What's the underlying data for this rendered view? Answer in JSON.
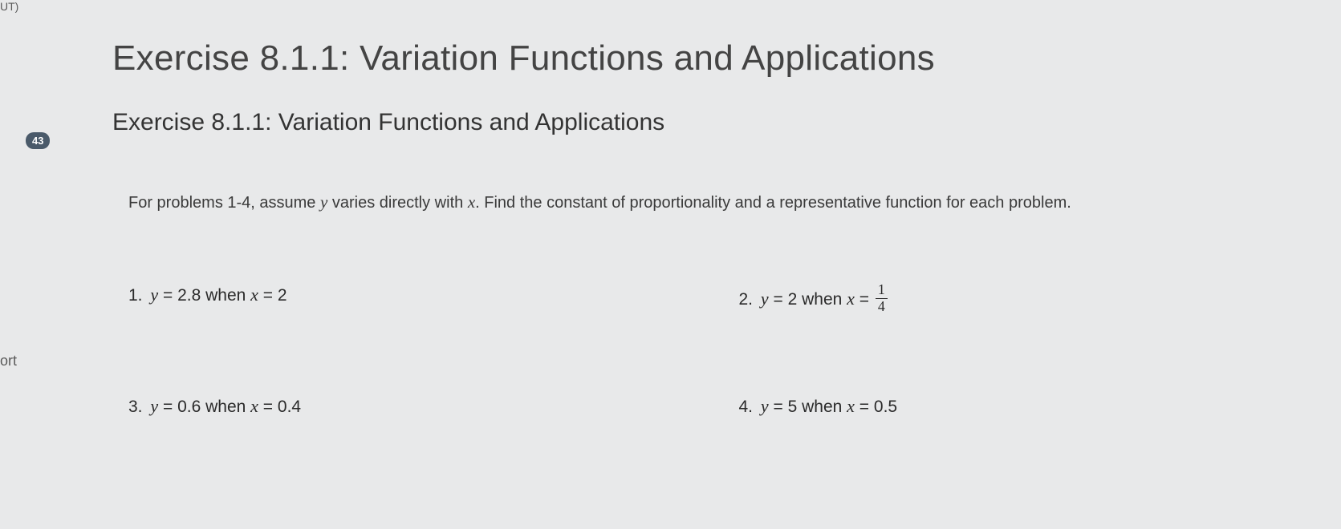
{
  "fragments": {
    "top_left": "UT)",
    "left": "ort"
  },
  "badge": "43",
  "title": "Exercise 8.1.1: Variation Functions and Applications",
  "subtitle": "Exercise 8.1.1: Variation Functions and Applications",
  "instructions": {
    "pre": "For problems 1-4, assume ",
    "var1": "y",
    "mid1": " varies directly with ",
    "var2": "x",
    "post": ". Find the constant of proportionality and a representative function for each problem."
  },
  "problems": [
    {
      "n": "1.",
      "y": "2.8",
      "x": "2",
      "x_is_fraction": false
    },
    {
      "n": "2.",
      "y": "2",
      "x": "1/4",
      "x_is_fraction": true,
      "x_num": "1",
      "x_den": "4"
    },
    {
      "n": "3.",
      "y": "0.6",
      "x": "0.4",
      "x_is_fraction": false
    },
    {
      "n": "4.",
      "y": "5",
      "x": "0.5",
      "x_is_fraction": false
    }
  ]
}
